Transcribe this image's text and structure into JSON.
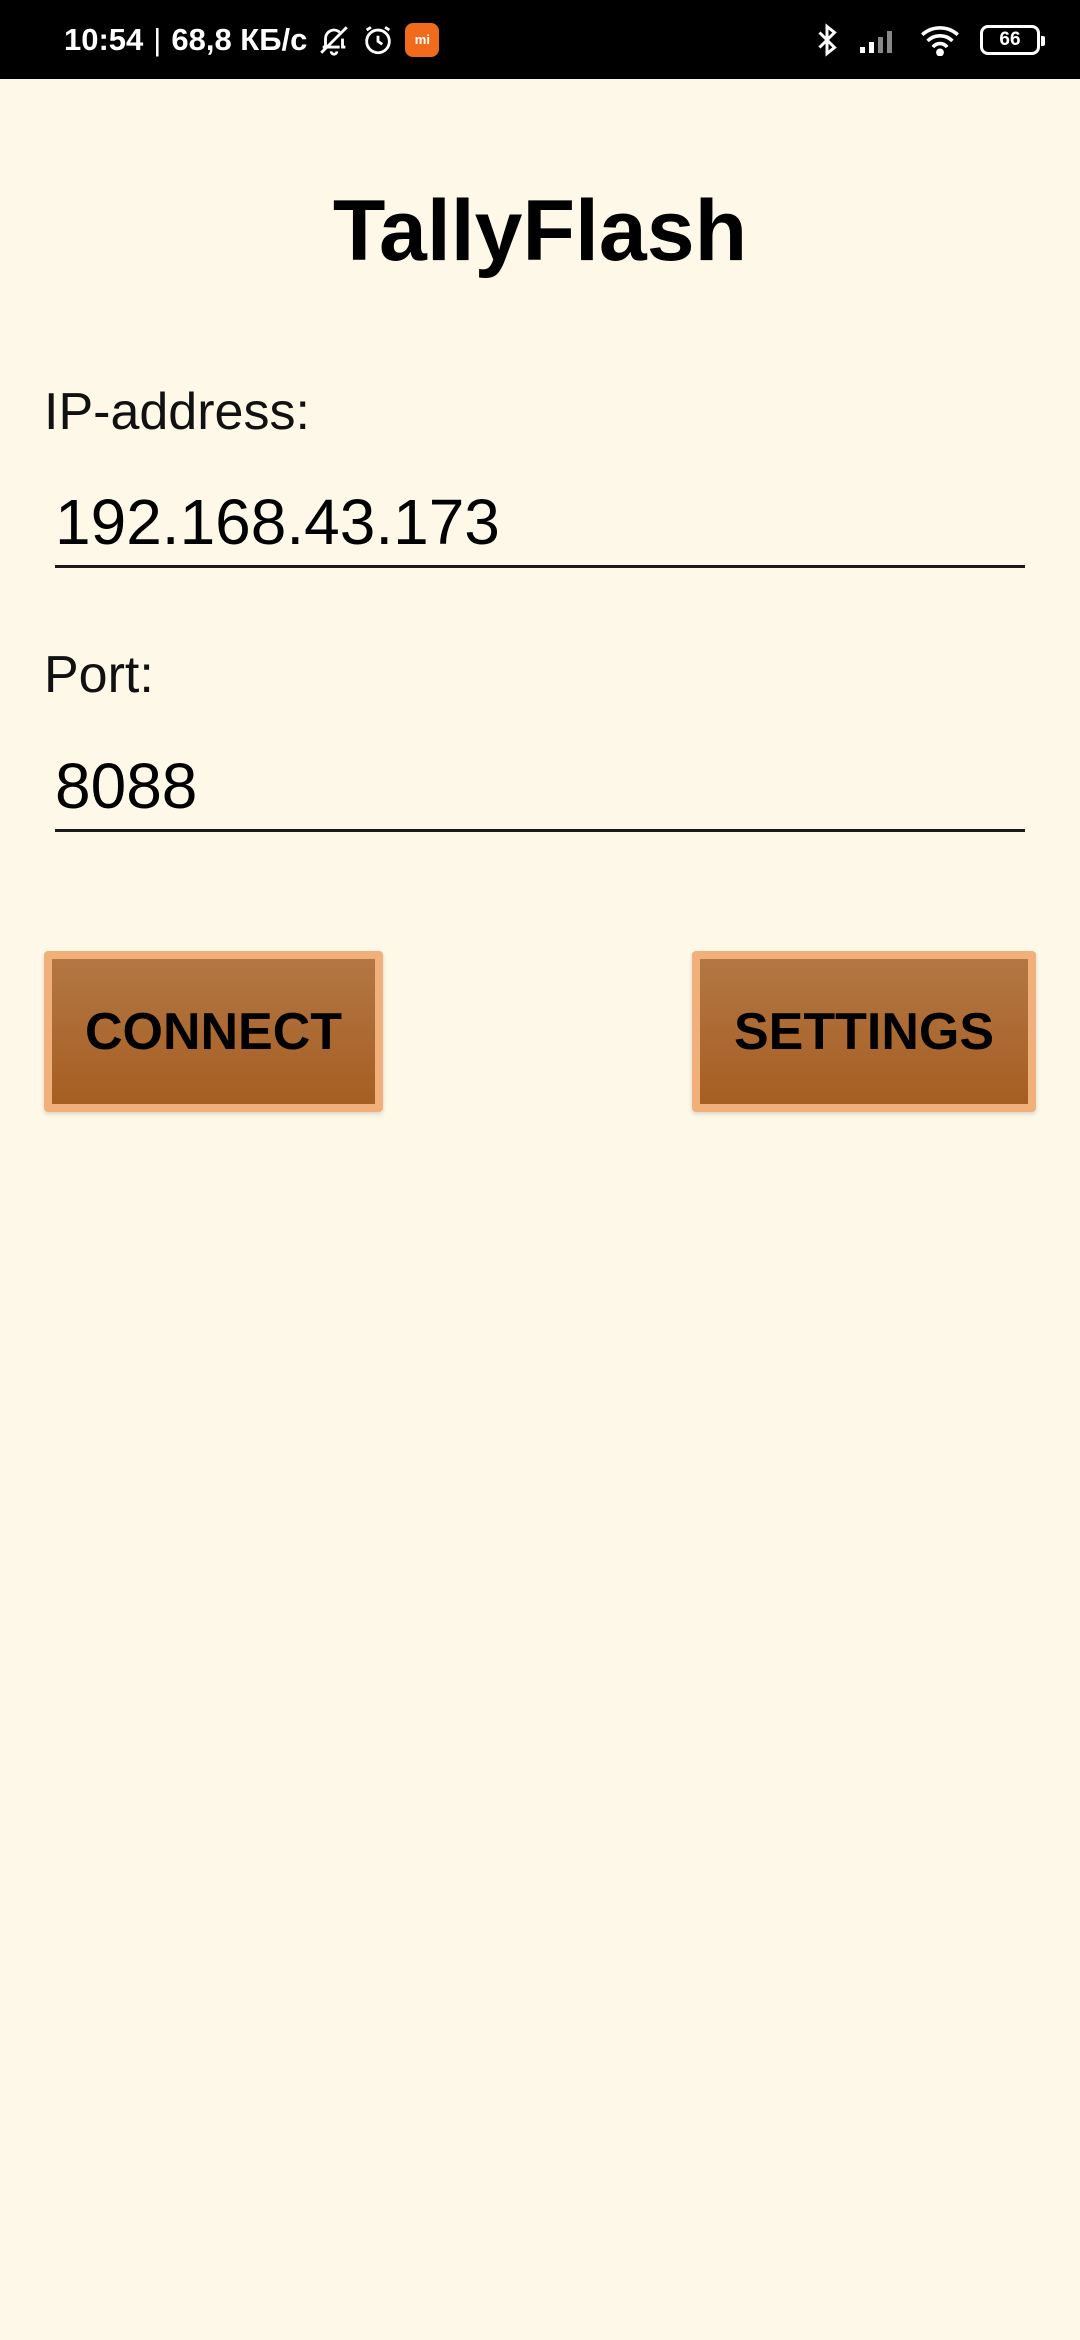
{
  "status_bar": {
    "time": "10:54",
    "separator": "|",
    "net_speed": "68,8 КБ/с",
    "mi_badge": "mi",
    "battery": "66",
    "icons": [
      "bell-off-icon",
      "alarm-icon",
      "mi-app-icon",
      "bluetooth-icon",
      "signal-icon",
      "wifi-icon",
      "battery-icon"
    ]
  },
  "app": {
    "title": "TallyFlash",
    "ip": {
      "label": "IP-address:",
      "value": "192.168.43.173"
    },
    "port": {
      "label": "Port:",
      "value": "8088"
    },
    "buttons": {
      "connect": "CONNECT",
      "settings": "SETTINGS"
    }
  },
  "colors": {
    "background": "#fdf8e8",
    "button_fill": "#a65e22",
    "button_border": "#f1b07a"
  }
}
